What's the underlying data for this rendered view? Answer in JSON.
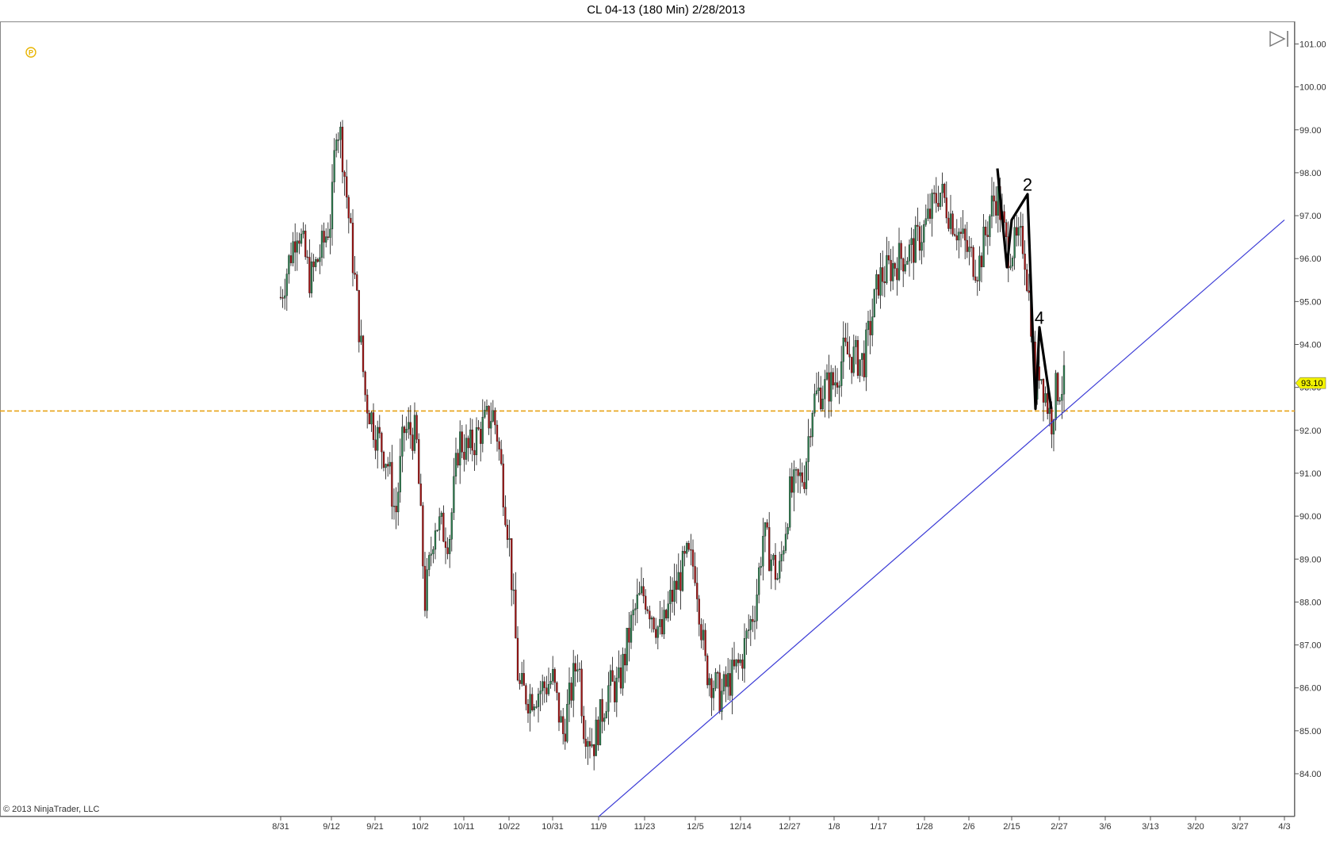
{
  "window": {
    "title": "CL 04-13 (180 Min)  2/28/2013"
  },
  "footer": {
    "copyright": "© 2013 NinjaTrader, LLC"
  },
  "toolbar": {
    "icon": "play-to-end-icon"
  },
  "colors": {
    "up": "#2e7d4f",
    "down": "#a11616",
    "hline": "#e8a317",
    "trend": "#3b3bd6",
    "price_tag": "#f2f200"
  },
  "chart_data": {
    "type": "candlestick",
    "title": "CL 04-13 (180 Min)  2/28/2013",
    "ylim": [
      83,
      101.5
    ],
    "y_ticks": [
      "84.00",
      "85.00",
      "86.00",
      "87.00",
      "88.00",
      "89.00",
      "90.00",
      "91.00",
      "92.00",
      "93.00",
      "94.00",
      "95.00",
      "96.00",
      "97.00",
      "98.00",
      "99.00",
      "100.00",
      "101.00"
    ],
    "x_ticks": [
      "8/31",
      "9/12",
      "9/21",
      "10/2",
      "10/11",
      "10/22",
      "10/31",
      "11/9",
      "11/23",
      "12/5",
      "12/14",
      "12/27",
      "1/8",
      "1/17",
      "1/28",
      "2/6",
      "2/15",
      "2/27",
      "3/6",
      "3/13",
      "3/20",
      "3/27",
      "4/3"
    ],
    "last_price": "93.10",
    "horizontal_line": 92.45,
    "trendline": [
      {
        "date": "11/9",
        "price": 83
      },
      {
        "date": "4/3",
        "price": 96.9
      }
    ],
    "price_path": [
      {
        "date": "8/31",
        "price": 95.1
      },
      {
        "date": "9/4",
        "price": 96.8
      },
      {
        "date": "9/7",
        "price": 95.5
      },
      {
        "date": "9/10",
        "price": 96.3
      },
      {
        "date": "9/12",
        "price": 97.0
      },
      {
        "date": "9/13",
        "price": 99.2
      },
      {
        "date": "9/14",
        "price": 98.8
      },
      {
        "date": "9/17",
        "price": 95.3
      },
      {
        "date": "9/19",
        "price": 92.8
      },
      {
        "date": "9/21",
        "price": 92.0
      },
      {
        "date": "9/24",
        "price": 91.3
      },
      {
        "date": "9/26",
        "price": 90.0
      },
      {
        "date": "9/28",
        "price": 92.0
      },
      {
        "date": "10/1",
        "price": 91.9
      },
      {
        "date": "10/3",
        "price": 88.0
      },
      {
        "date": "10/5",
        "price": 89.9
      },
      {
        "date": "10/8",
        "price": 89.5
      },
      {
        "date": "10/10",
        "price": 91.8
      },
      {
        "date": "10/12",
        "price": 91.5
      },
      {
        "date": "10/15",
        "price": 92.0
      },
      {
        "date": "10/18",
        "price": 92.4
      },
      {
        "date": "10/19",
        "price": 92.0
      },
      {
        "date": "10/22",
        "price": 89.5
      },
      {
        "date": "10/24",
        "price": 86.0
      },
      {
        "date": "10/26",
        "price": 85.8
      },
      {
        "date": "10/29",
        "price": 86.0
      },
      {
        "date": "10/31",
        "price": 86.2
      },
      {
        "date": "11/2",
        "price": 84.9
      },
      {
        "date": "11/5",
        "price": 86.8
      },
      {
        "date": "11/6",
        "price": 85.2
      },
      {
        "date": "11/8",
        "price": 84.7
      },
      {
        "date": "11/12",
        "price": 86.0
      },
      {
        "date": "11/15",
        "price": 86.0
      },
      {
        "date": "11/19",
        "price": 87.5
      },
      {
        "date": "11/21",
        "price": 88.0
      },
      {
        "date": "11/23",
        "price": 88.2
      },
      {
        "date": "11/27",
        "price": 87.2
      },
      {
        "date": "11/29",
        "price": 88.0
      },
      {
        "date": "12/3",
        "price": 89.0
      },
      {
        "date": "12/5",
        "price": 88.8
      },
      {
        "date": "12/7",
        "price": 86.5
      },
      {
        "date": "12/10",
        "price": 85.8
      },
      {
        "date": "12/12",
        "price": 86.2
      },
      {
        "date": "12/14",
        "price": 86.6
      },
      {
        "date": "12/18",
        "price": 88.0
      },
      {
        "date": "12/20",
        "price": 89.6
      },
      {
        "date": "12/24",
        "price": 88.5
      },
      {
        "date": "12/27",
        "price": 90.5
      },
      {
        "date": "12/31",
        "price": 91.0
      },
      {
        "date": "1/2",
        "price": 92.6
      },
      {
        "date": "1/4",
        "price": 92.9
      },
      {
        "date": "1/8",
        "price": 93.1
      },
      {
        "date": "1/10",
        "price": 93.8
      },
      {
        "date": "1/14",
        "price": 93.6
      },
      {
        "date": "1/17",
        "price": 95.5
      },
      {
        "date": "1/22",
        "price": 96.0
      },
      {
        "date": "1/25",
        "price": 96.2
      },
      {
        "date": "1/28",
        "price": 96.7
      },
      {
        "date": "1/31",
        "price": 97.6
      },
      {
        "date": "2/4",
        "price": 96.6
      },
      {
        "date": "2/6",
        "price": 96.1
      },
      {
        "date": "2/8",
        "price": 95.8
      },
      {
        "date": "2/11",
        "price": 97.3
      },
      {
        "date": "2/12",
        "price": 97.5
      },
      {
        "date": "2/14",
        "price": 96.2
      },
      {
        "date": "2/18",
        "price": 96.4
      },
      {
        "date": "2/20",
        "price": 94.5
      },
      {
        "date": "2/21",
        "price": 92.8
      },
      {
        "date": "2/22",
        "price": 93.5
      },
      {
        "date": "2/25",
        "price": 92.2
      },
      {
        "date": "2/26",
        "price": 92.9
      },
      {
        "date": "2/27",
        "price": 93.0
      },
      {
        "date": "2/28",
        "price": 93.1
      }
    ],
    "wave_labels": [
      {
        "label": "2",
        "date": "2/19",
        "price": 97.4
      },
      {
        "label": "4",
        "date": "2/22",
        "price": 94.3
      }
    ],
    "wave_lines": [
      {
        "date": "2/12",
        "price": 98.1
      },
      {
        "date": "2/14",
        "price": 95.8
      },
      {
        "date": "2/15",
        "price": 96.9
      },
      {
        "date": "2/19",
        "price": 97.5
      },
      {
        "date": "2/21",
        "price": 92.5
      },
      {
        "date": "2/22",
        "price": 94.4
      },
      {
        "date": "2/25",
        "price": 92.5
      }
    ]
  }
}
